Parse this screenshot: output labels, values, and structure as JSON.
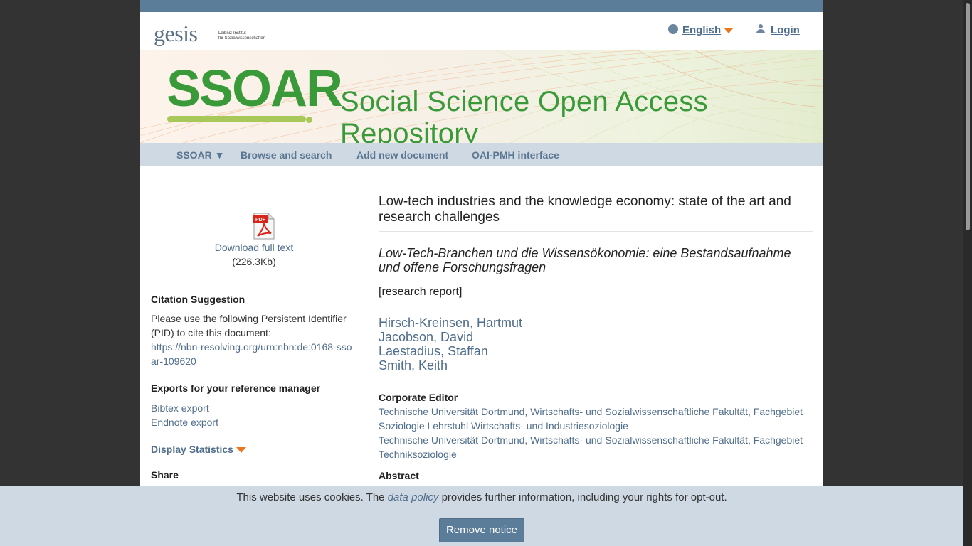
{
  "header": {
    "logo_text": "gesis",
    "logo_subtitle_line1": "Leibniz-Institut",
    "logo_subtitle_line2": "für Sozialwissenschaften",
    "language_label": "English",
    "login_label": "Login"
  },
  "banner": {
    "logo": "SSOAR",
    "tagline": "Social Science Open Access Repository"
  },
  "nav": {
    "items": [
      "SSOAR ▼",
      "Browse and search",
      "Add new document",
      "OAI-PMH interface"
    ]
  },
  "sidebar": {
    "download_label": "Download full text",
    "file_size": "(226.3Kb)",
    "citation_heading": "Citation Suggestion",
    "citation_text": "Please use the following Persistent Identifier (PID) to cite this document:",
    "pid_link": "https://nbn-resolving.org/urn:nbn:de:0168-ssoar-109620",
    "exports_heading": "Exports for your reference manager",
    "bibtex_label": "Bibtex export",
    "endnote_label": "Endnote export",
    "statistics_label": "Display Statistics",
    "share_heading": "Share"
  },
  "document": {
    "title": "Low-tech industries and the knowledge economy: state of the art and research challenges",
    "alt_title": "Low-Tech-Branchen und die Wissensökonomie: eine Bestandsaufnahme und offene Forschungsfragen",
    "type": "[research report]",
    "authors": [
      "Hirsch-Kreinsen, Hartmut",
      "Jacobson, David",
      "Laestadius, Staffan",
      "Smith, Keith"
    ],
    "corporate_editor_heading": "Corporate Editor",
    "corporate_editors": [
      "Technische Universität Dortmund, Wirtschafts- und Sozialwissenschaftliche Fakultät, Fachgebiet Soziologie Lehrstuhl Wirtschafts- und Industriesoziologie",
      "Technische Universität Dortmund, Wirtschafts- und Sozialwissenschaftliche Fakultät, Fachgebiet Techniksoziologie"
    ],
    "abstract_heading": "Abstract"
  },
  "cookie": {
    "text_before": "This website uses cookies. The ",
    "link_text": "data policy",
    "text_after": " provides further information, including your rights for opt-out.",
    "button_label": "Remove notice"
  },
  "pdf_icon_label": "PDF",
  "colors": {
    "accent_blue": "#4f6d8c",
    "brand_green": "#3a9a3a",
    "accent_orange": "#e87722",
    "nav_background": "#cfd9e3"
  }
}
